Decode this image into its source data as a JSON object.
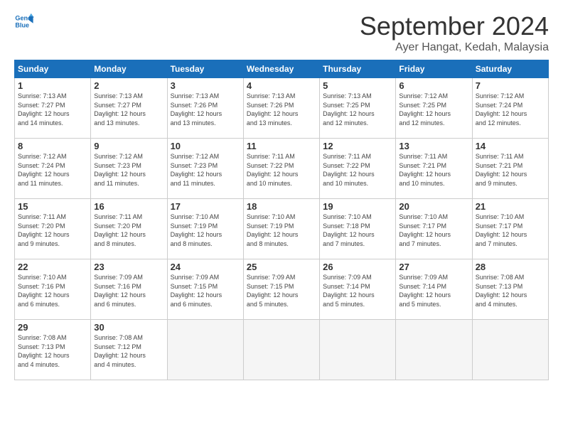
{
  "logo": {
    "line1": "General",
    "line2": "Blue"
  },
  "title": "September 2024",
  "subtitle": "Ayer Hangat, Kedah, Malaysia",
  "days_header": [
    "Sunday",
    "Monday",
    "Tuesday",
    "Wednesday",
    "Thursday",
    "Friday",
    "Saturday"
  ],
  "weeks": [
    [
      {
        "day": "1",
        "info": "Sunrise: 7:13 AM\nSunset: 7:27 PM\nDaylight: 12 hours\nand 14 minutes."
      },
      {
        "day": "2",
        "info": "Sunrise: 7:13 AM\nSunset: 7:27 PM\nDaylight: 12 hours\nand 13 minutes."
      },
      {
        "day": "3",
        "info": "Sunrise: 7:13 AM\nSunset: 7:26 PM\nDaylight: 12 hours\nand 13 minutes."
      },
      {
        "day": "4",
        "info": "Sunrise: 7:13 AM\nSunset: 7:26 PM\nDaylight: 12 hours\nand 13 minutes."
      },
      {
        "day": "5",
        "info": "Sunrise: 7:13 AM\nSunset: 7:25 PM\nDaylight: 12 hours\nand 12 minutes."
      },
      {
        "day": "6",
        "info": "Sunrise: 7:12 AM\nSunset: 7:25 PM\nDaylight: 12 hours\nand 12 minutes."
      },
      {
        "day": "7",
        "info": "Sunrise: 7:12 AM\nSunset: 7:24 PM\nDaylight: 12 hours\nand 12 minutes."
      }
    ],
    [
      {
        "day": "8",
        "info": "Sunrise: 7:12 AM\nSunset: 7:24 PM\nDaylight: 12 hours\nand 11 minutes."
      },
      {
        "day": "9",
        "info": "Sunrise: 7:12 AM\nSunset: 7:23 PM\nDaylight: 12 hours\nand 11 minutes."
      },
      {
        "day": "10",
        "info": "Sunrise: 7:12 AM\nSunset: 7:23 PM\nDaylight: 12 hours\nand 11 minutes."
      },
      {
        "day": "11",
        "info": "Sunrise: 7:11 AM\nSunset: 7:22 PM\nDaylight: 12 hours\nand 10 minutes."
      },
      {
        "day": "12",
        "info": "Sunrise: 7:11 AM\nSunset: 7:22 PM\nDaylight: 12 hours\nand 10 minutes."
      },
      {
        "day": "13",
        "info": "Sunrise: 7:11 AM\nSunset: 7:21 PM\nDaylight: 12 hours\nand 10 minutes."
      },
      {
        "day": "14",
        "info": "Sunrise: 7:11 AM\nSunset: 7:21 PM\nDaylight: 12 hours\nand 9 minutes."
      }
    ],
    [
      {
        "day": "15",
        "info": "Sunrise: 7:11 AM\nSunset: 7:20 PM\nDaylight: 12 hours\nand 9 minutes."
      },
      {
        "day": "16",
        "info": "Sunrise: 7:11 AM\nSunset: 7:20 PM\nDaylight: 12 hours\nand 8 minutes."
      },
      {
        "day": "17",
        "info": "Sunrise: 7:10 AM\nSunset: 7:19 PM\nDaylight: 12 hours\nand 8 minutes."
      },
      {
        "day": "18",
        "info": "Sunrise: 7:10 AM\nSunset: 7:19 PM\nDaylight: 12 hours\nand 8 minutes."
      },
      {
        "day": "19",
        "info": "Sunrise: 7:10 AM\nSunset: 7:18 PM\nDaylight: 12 hours\nand 7 minutes."
      },
      {
        "day": "20",
        "info": "Sunrise: 7:10 AM\nSunset: 7:17 PM\nDaylight: 12 hours\nand 7 minutes."
      },
      {
        "day": "21",
        "info": "Sunrise: 7:10 AM\nSunset: 7:17 PM\nDaylight: 12 hours\nand 7 minutes."
      }
    ],
    [
      {
        "day": "22",
        "info": "Sunrise: 7:10 AM\nSunset: 7:16 PM\nDaylight: 12 hours\nand 6 minutes."
      },
      {
        "day": "23",
        "info": "Sunrise: 7:09 AM\nSunset: 7:16 PM\nDaylight: 12 hours\nand 6 minutes."
      },
      {
        "day": "24",
        "info": "Sunrise: 7:09 AM\nSunset: 7:15 PM\nDaylight: 12 hours\nand 6 minutes."
      },
      {
        "day": "25",
        "info": "Sunrise: 7:09 AM\nSunset: 7:15 PM\nDaylight: 12 hours\nand 5 minutes."
      },
      {
        "day": "26",
        "info": "Sunrise: 7:09 AM\nSunset: 7:14 PM\nDaylight: 12 hours\nand 5 minutes."
      },
      {
        "day": "27",
        "info": "Sunrise: 7:09 AM\nSunset: 7:14 PM\nDaylight: 12 hours\nand 5 minutes."
      },
      {
        "day": "28",
        "info": "Sunrise: 7:08 AM\nSunset: 7:13 PM\nDaylight: 12 hours\nand 4 minutes."
      }
    ],
    [
      {
        "day": "29",
        "info": "Sunrise: 7:08 AM\nSunset: 7:13 PM\nDaylight: 12 hours\nand 4 minutes."
      },
      {
        "day": "30",
        "info": "Sunrise: 7:08 AM\nSunset: 7:12 PM\nDaylight: 12 hours\nand 4 minutes."
      },
      {
        "day": "",
        "info": ""
      },
      {
        "day": "",
        "info": ""
      },
      {
        "day": "",
        "info": ""
      },
      {
        "day": "",
        "info": ""
      },
      {
        "day": "",
        "info": ""
      }
    ]
  ]
}
